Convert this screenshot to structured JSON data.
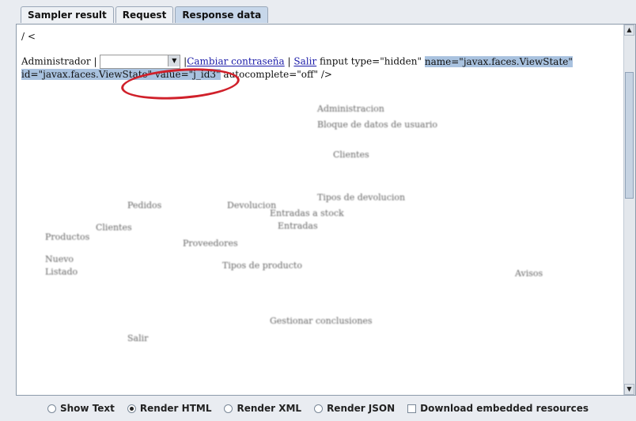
{
  "tabs": [
    {
      "label": "Sampler result",
      "active": false
    },
    {
      "label": "Request",
      "active": false
    },
    {
      "label": "Response data",
      "active": true
    }
  ],
  "content": {
    "first_line": "/ <",
    "user_label": "Administrador |",
    "link_change_password": "Cambiar contraseña",
    "separator": "|",
    "link_logout": "Salir",
    "raw_text_1": "finput type=\"hidden\"",
    "hl_name": "name=\"javax.faces.ViewState\"",
    "hl_id_line": "id=\"javax.faces.ViewState\" value=\"j_id3\"",
    "raw_text_2": " autocomplete=\"off\" />",
    "blurred": [
      "Administracion",
      "Bloque de datos de usuario",
      "Clientes",
      "Productos",
      "Clientes",
      "Pedidos",
      "Devolucion",
      "Avisos",
      "Nuevo",
      "Listado",
      "Proveedores",
      "Entradas",
      "Tipos de producto",
      "Salir",
      "Entradas a stock",
      "Tipos de devolucion",
      "Gestionar conclusiones"
    ]
  },
  "bottom_options": {
    "show_text": "Show Text",
    "render_html": "Render HTML",
    "render_xml": "Render XML",
    "render_json": "Render JSON",
    "download_embedded": "Download embedded resources",
    "selected": "render_html"
  },
  "colors": {
    "highlight": "#a9c2df",
    "annotation_oval": "#d0202a",
    "link": "#1a1aa8"
  }
}
